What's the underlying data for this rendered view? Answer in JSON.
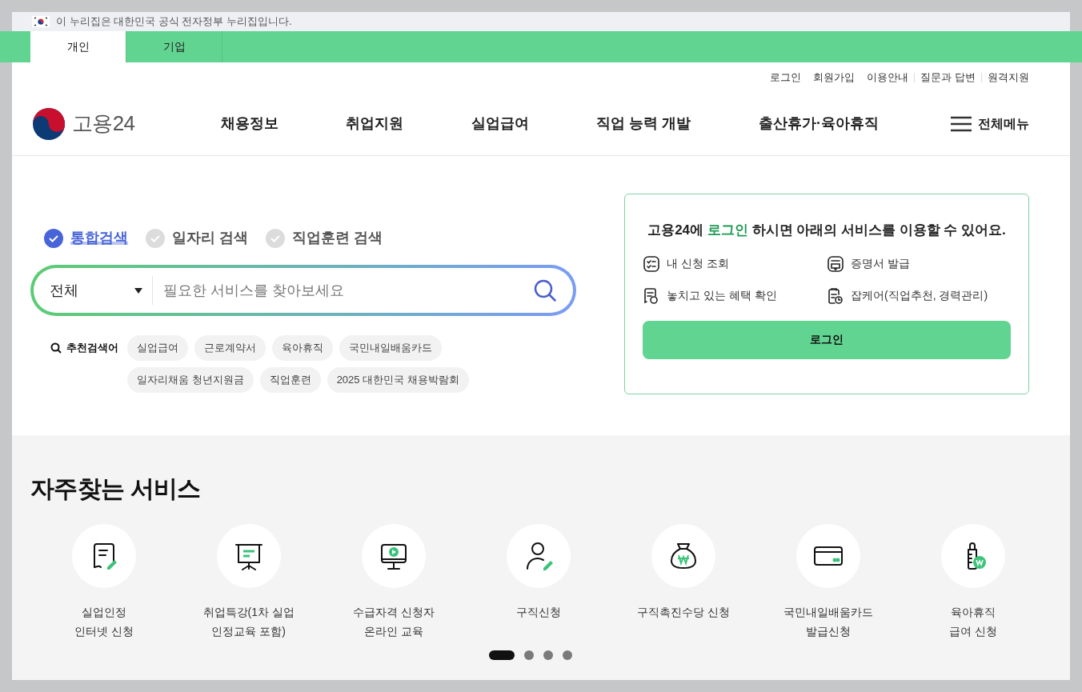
{
  "gov_banner": {
    "text": "이 누리집은 대한민국 공식 전자정부 누리집입니다."
  },
  "audience_tabs": [
    {
      "label": "개인",
      "selected": true
    },
    {
      "label": "기업",
      "selected": false
    }
  ],
  "utility_links": [
    "로그인",
    "회원가입",
    "이용안내",
    "질문과 답변",
    "원격지원"
  ],
  "logo": {
    "text": "고용24"
  },
  "nav": [
    "채용정보",
    "취업지원",
    "실업급여",
    "직업 능력 개발",
    "출산휴가·육아휴직"
  ],
  "all_menu": {
    "label": "전체메뉴"
  },
  "search_types": [
    {
      "label": "통합검색",
      "selected": true
    },
    {
      "label": "일자리 검색",
      "selected": false
    },
    {
      "label": "직업훈련 검색",
      "selected": false
    }
  ],
  "search": {
    "scope": "전체",
    "placeholder": "필요한 서비스를 찾아보세요"
  },
  "recommended": {
    "label": "추천검색어",
    "keywords": [
      "실업급여",
      "근로계약서",
      "육아휴직",
      "국민내일배움카드",
      "일자리채움 청년지원금",
      "직업훈련",
      "2025 대한민국 채용박람회"
    ]
  },
  "login_card": {
    "message": "고용24에 **로그인** 하시면 아래의 서비스를 이용할 수 있어요.",
    "services": [
      {
        "kind": "list",
        "label": "내 신청 조회"
      },
      {
        "kind": "certificate",
        "label": "증명서 발급"
      },
      {
        "kind": "benefit",
        "label": "놓치고 있는 혜택 확인"
      },
      {
        "kind": "clipboard",
        "label": "잡케어(직업추천, 경력관리)"
      }
    ],
    "button": "로그인"
  },
  "frequent": {
    "title": "자주찾는 서비스",
    "items": [
      {
        "kind": "doc",
        "lines": [
          "실업인정",
          "인터넷 신청"
        ]
      },
      {
        "kind": "board",
        "lines": [
          "취업특강(1차 실업",
          "인정교육 포함)"
        ]
      },
      {
        "kind": "monitor",
        "lines": [
          "수급자격 신청자",
          "온라인 교육"
        ]
      },
      {
        "kind": "person",
        "lines": [
          "구직신청"
        ]
      },
      {
        "kind": "moneybag",
        "lines": [
          "구직촉진수당 신청"
        ]
      },
      {
        "kind": "card",
        "lines": [
          "국민내일배움카드",
          "발급신청"
        ]
      },
      {
        "kind": "bottle",
        "lines": [
          "육아휴직",
          "급여 신청"
        ]
      }
    ],
    "pages": [
      {
        "selected": true
      },
      {
        "selected": false
      },
      {
        "selected": false
      },
      {
        "selected": false
      }
    ]
  }
}
